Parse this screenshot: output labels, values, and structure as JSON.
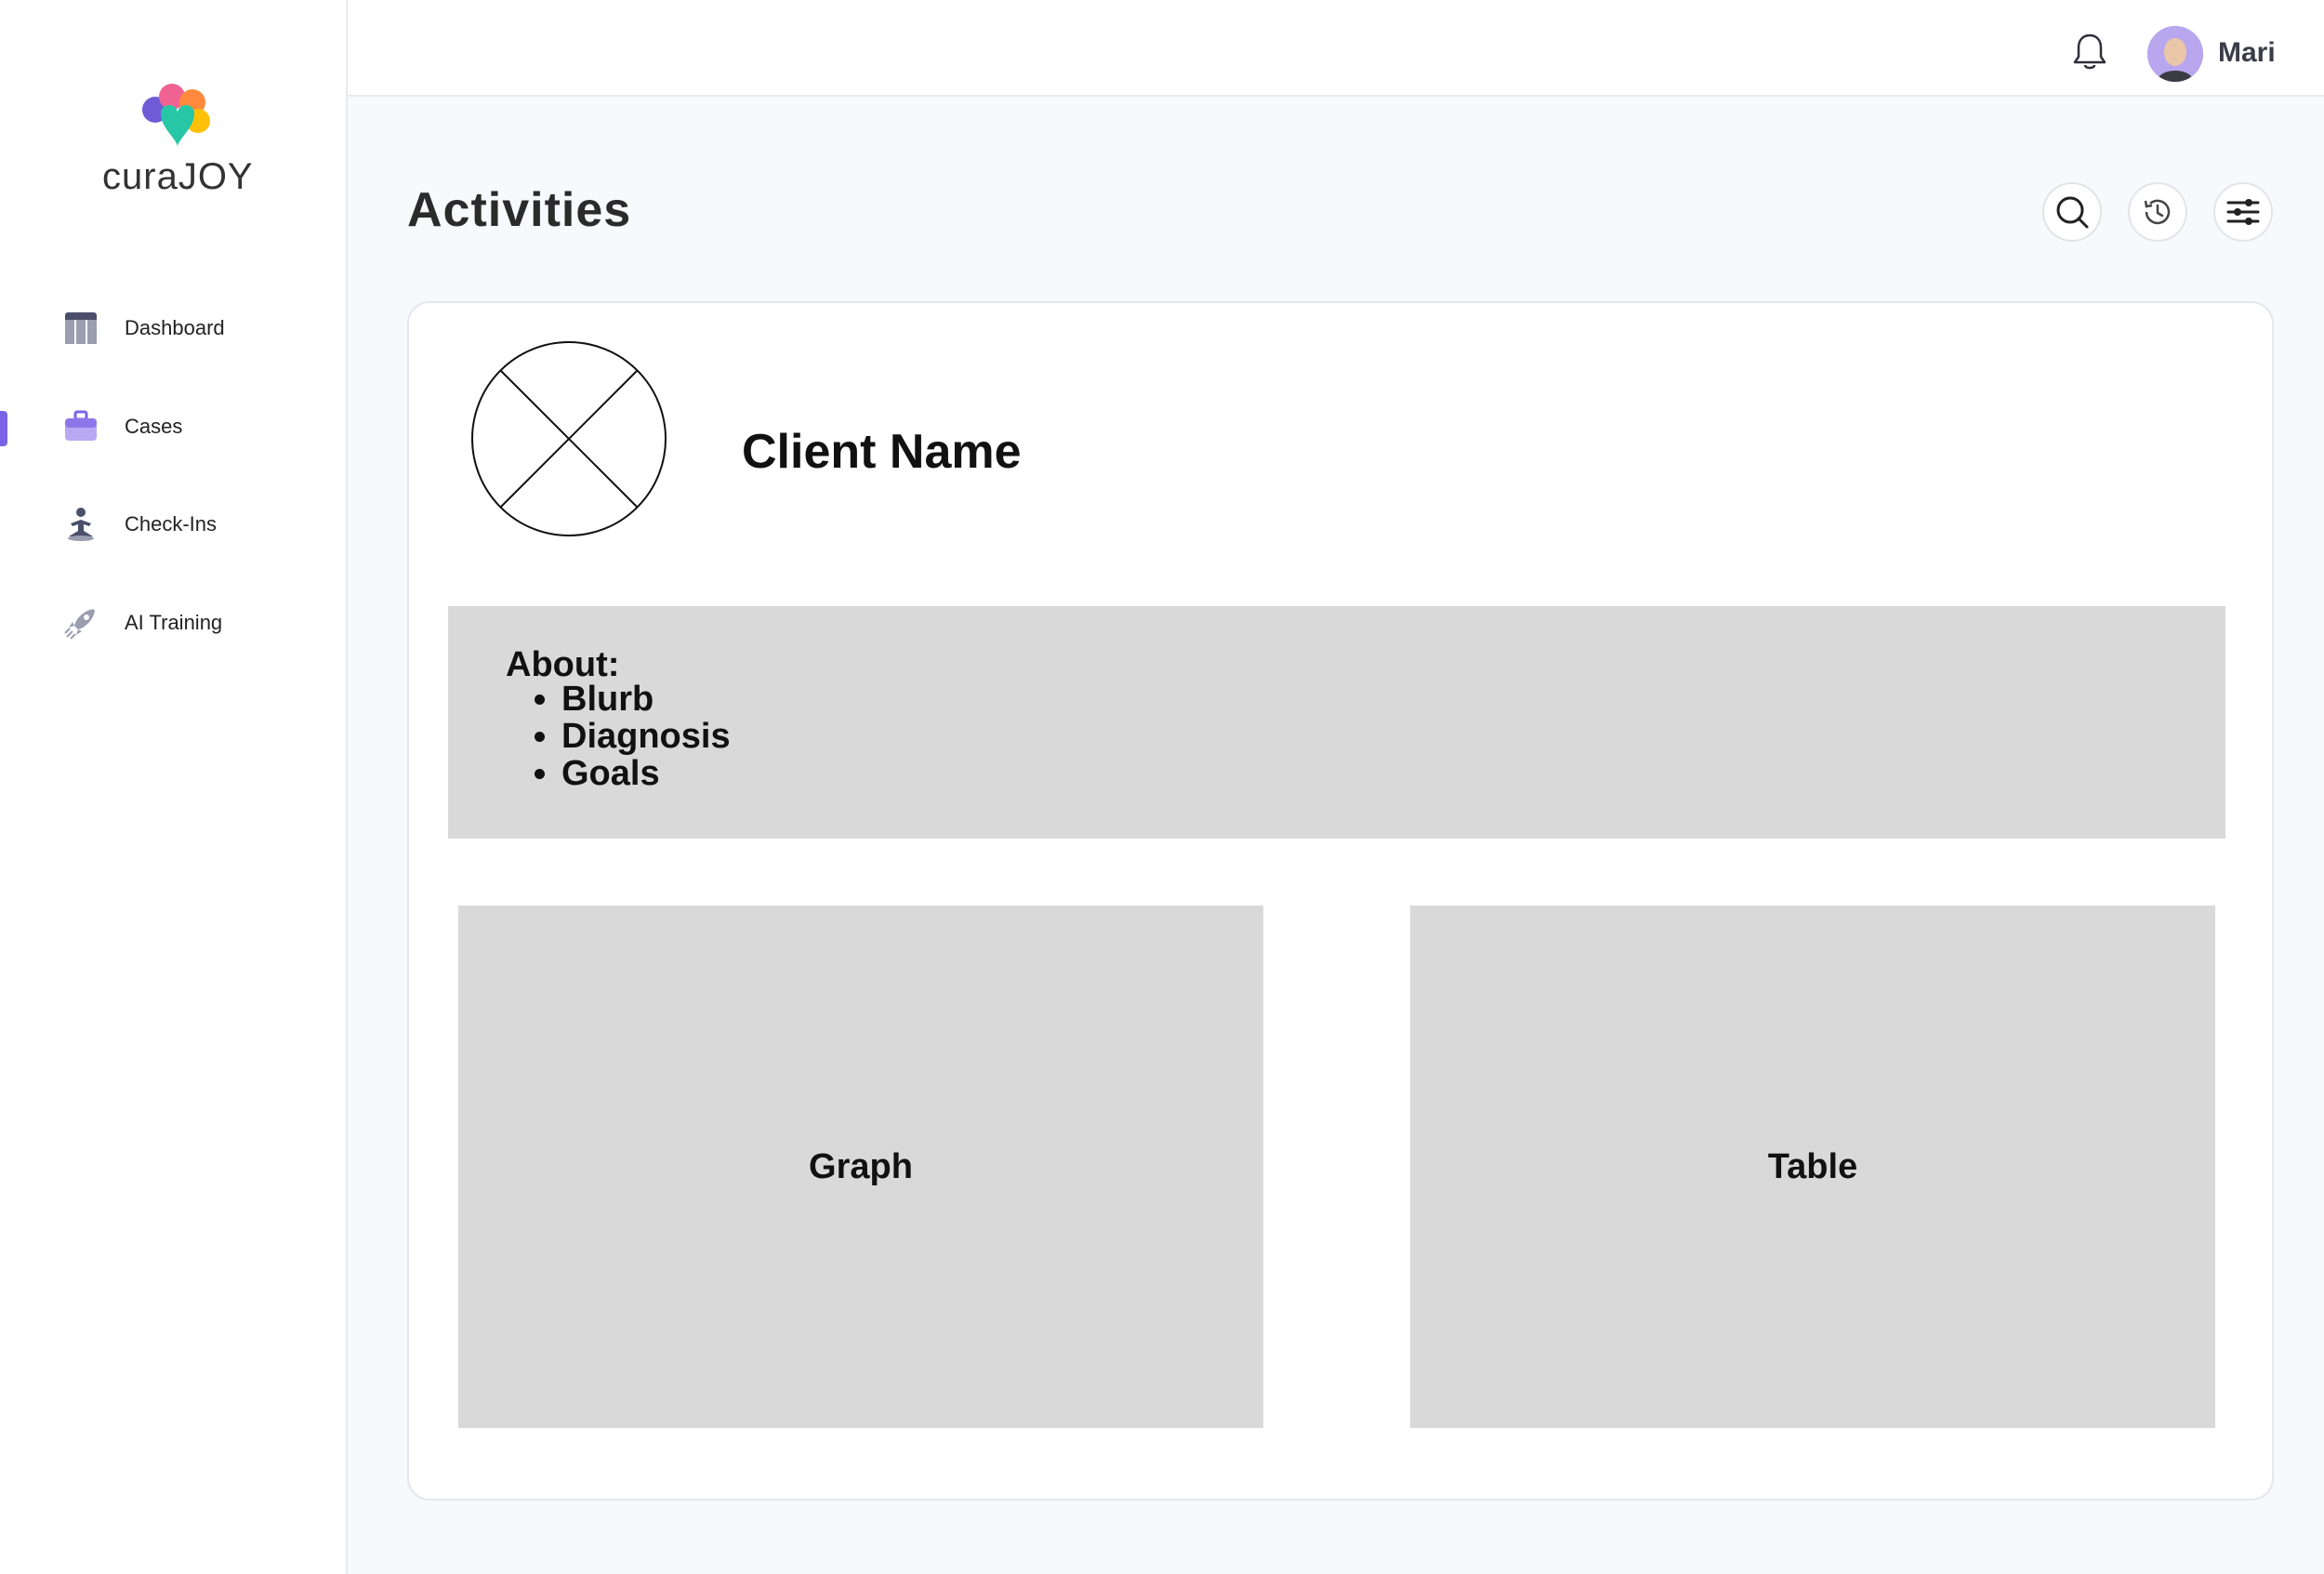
{
  "brand": {
    "name": "curaJOY"
  },
  "sidebar": {
    "items": [
      {
        "label": "Dashboard",
        "icon": "dashboard-icon"
      },
      {
        "label": "Cases",
        "icon": "briefcase-icon",
        "active": true
      },
      {
        "label": "Check-Ins",
        "icon": "meditation-icon"
      },
      {
        "label": "AI Training",
        "icon": "rocket-icon"
      }
    ]
  },
  "topbar": {
    "user_name": "Mari",
    "icons": [
      "bell-icon",
      "avatar"
    ]
  },
  "header": {
    "title": "Activities",
    "tools": [
      "search-icon",
      "history-icon",
      "filter-sliders-icon"
    ]
  },
  "client": {
    "name": "Client Name",
    "about_title": "About:",
    "about_items": [
      "Blurb",
      "Diagnosis",
      "Goals"
    ],
    "graph_label": "Graph",
    "table_label": "Table"
  },
  "colors": {
    "accent": "#7a63e6",
    "placeholder": "#d9d9d9",
    "background": "#f8f9fc"
  }
}
